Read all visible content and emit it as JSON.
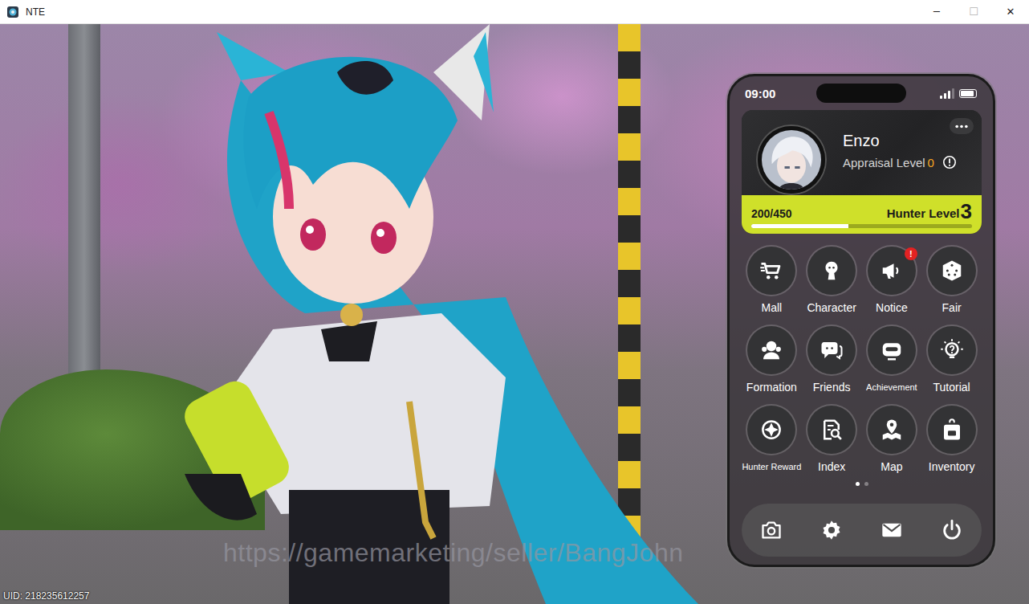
{
  "window": {
    "title": "NTE",
    "controls": [
      {
        "glyph": "─",
        "disabled": false
      },
      {
        "glyph": "☐",
        "disabled": true
      },
      {
        "glyph": "✕",
        "disabled": false
      }
    ]
  },
  "phone": {
    "status_bar": {
      "time": "09:00",
      "signal": {
        "level": 0.75
      },
      "battery": {
        "level": 0.9
      }
    },
    "profile": {
      "name": "Enzo",
      "appraisal_label": "Appraisal Level",
      "appraisal_value": "0",
      "xp": "200/450",
      "hunter_label": "Hunter Level",
      "hunter_value": "3",
      "level": 0.44
    },
    "apps": [
      {
        "label": "Mall",
        "badge": null
      },
      {
        "label": "Character",
        "badge": null
      },
      {
        "label": "Notice",
        "badge": "!"
      },
      {
        "label": "Fair",
        "badge": null
      },
      {
        "label": "Formation",
        "badge": null
      },
      {
        "label": "Friends",
        "badge": null
      },
      {
        "label": "Achievement",
        "badge": null
      },
      {
        "label": "Tutorial",
        "badge": null
      },
      {
        "label": "Hunter Reward",
        "badge": null
      },
      {
        "label": "Index",
        "badge": null
      },
      {
        "label": "Map",
        "badge": null
      },
      {
        "label": "Inventory",
        "badge": null
      }
    ],
    "pages": [
      {
        "selected": true
      },
      {
        "selected": false
      }
    ]
  },
  "footer": {
    "uid": "UID: 218235612257"
  },
  "watermark": "https://gamemarketing/seller/BangJohn"
}
